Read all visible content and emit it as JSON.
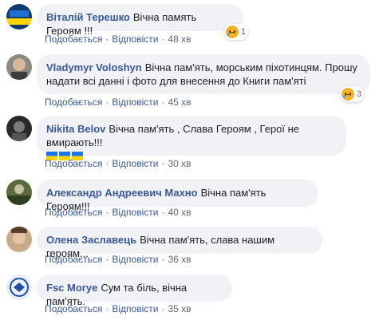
{
  "comments": [
    {
      "author": "Віталій Терешко",
      "text": "Вічна память Героям !!!",
      "like": "Подобається",
      "reply": "Відповісти",
      "time": "48 хв",
      "reaction_count": "1",
      "reaction_icon": "sad-emoji-icon"
    },
    {
      "author": "Vladymyr Voloshyn",
      "text": "Вічна пам'ять, морським піхотинцям. Прошу надати всі данні і фото для внесення до Книги пам'яті",
      "like": "Подобається",
      "reply": "Відповісти",
      "time": "45 хв",
      "reaction_count": "3",
      "reaction_icon": "sad-emoji-icon"
    },
    {
      "author": "Nikita Belov",
      "text": "Вічна пам'ять , Слава Героям , Герої не вмирають!!!",
      "emoji": "ukraine-flag x3",
      "like": "Подобається",
      "reply": "Відповісти",
      "time": "30 хв"
    },
    {
      "author": "Александр Андреевич Махно",
      "text": "Вічна пам'ять Героям!!!",
      "like": "Подобається",
      "reply": "Відповісти",
      "time": "40 хв"
    },
    {
      "author": "Олена Заславець",
      "text": "Вічна пам'ять, слава нашим героям...",
      "like": "Подобається",
      "reply": "Відповісти",
      "time": "36 хв"
    },
    {
      "author": "Fsc Morye",
      "text": "Сум та біль, вічна пам'ять.",
      "like": "Подобається",
      "reply": "Відповісти",
      "time": "35 хв"
    }
  ],
  "colors": {
    "link": "#385898",
    "bubble": "#f0f2f5",
    "meta": "#606770"
  }
}
